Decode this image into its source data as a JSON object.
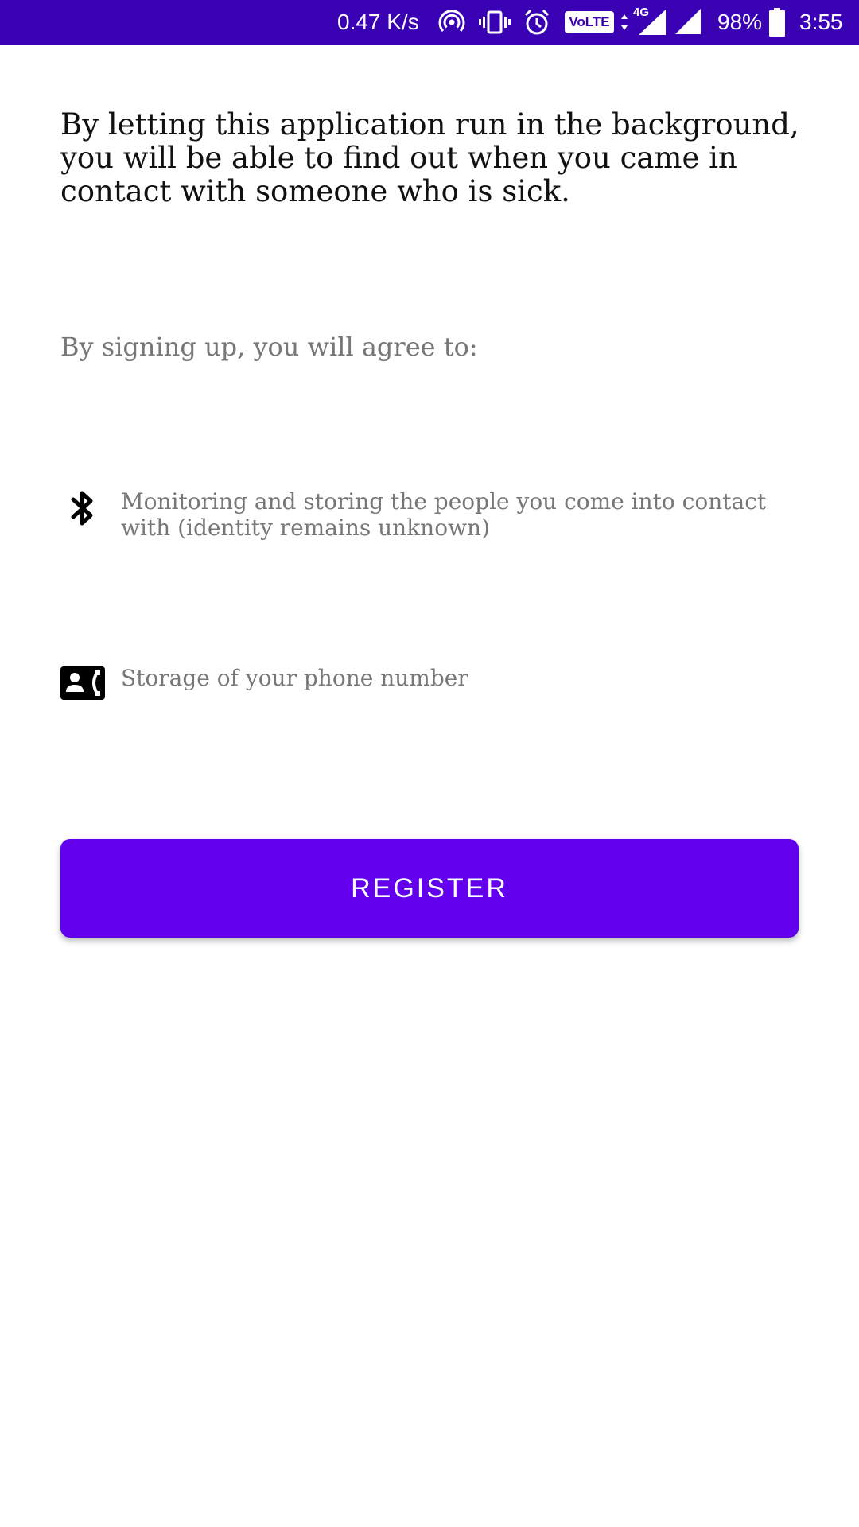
{
  "status_bar": {
    "network_speed": "0.47 K/s",
    "volte_label": "VoLTE",
    "network_type": "4G",
    "battery": "98%",
    "time": "3:55",
    "background_color": "#3a00b4",
    "icons": [
      "hotspot-icon",
      "vibrate-icon",
      "alarm-icon",
      "volte-icon",
      "signal-4g-icon",
      "signal-icon",
      "battery-icon"
    ]
  },
  "content": {
    "intro_text": "By letting this application run in the background, you will be able to find out when you came in contact with someone who is sick.",
    "agree_label": "By signing up, you will agree to:",
    "items": [
      {
        "icon": "bluetooth-icon",
        "text": "Monitoring and storing the people you come into contact with (identity remains unknown)"
      },
      {
        "icon": "contact-phone-icon",
        "text": "Storage of your phone number"
      }
    ]
  },
  "register_button": {
    "label": "REGISTER",
    "color": "#6200ee"
  }
}
